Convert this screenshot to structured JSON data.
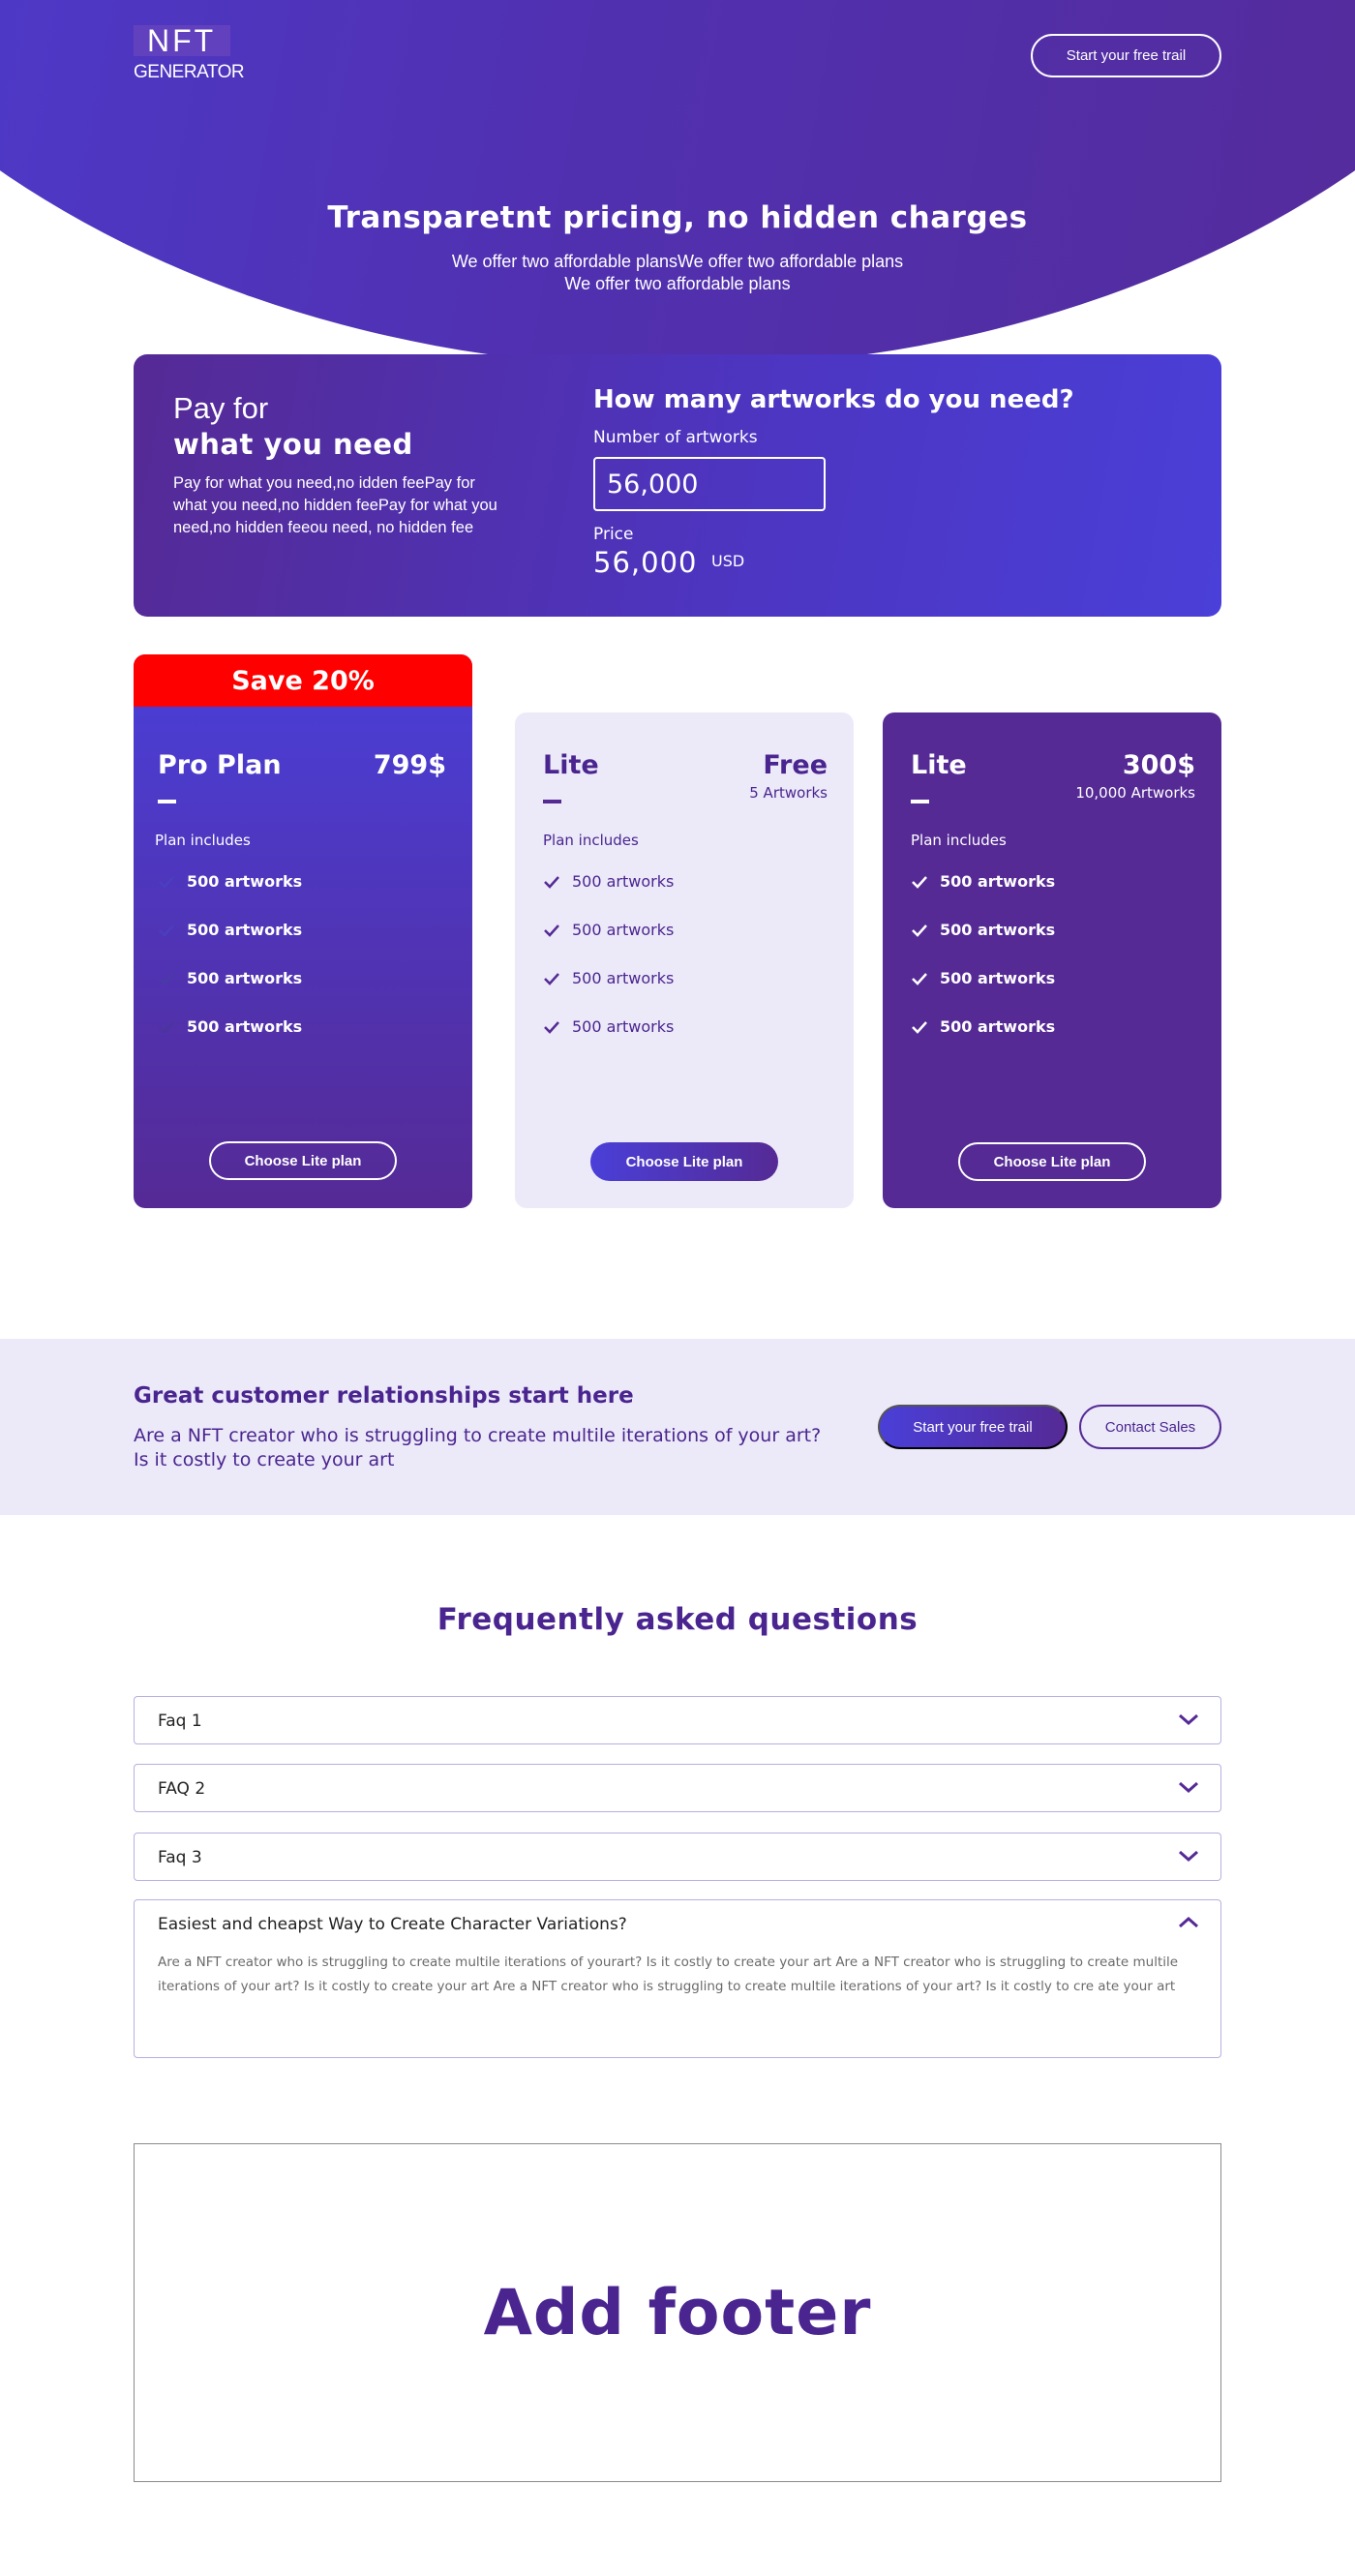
{
  "header": {
    "logo_top": "NFT",
    "logo_bottom": "GENERATOR",
    "cta_label": "Start your free trail"
  },
  "hero": {
    "title": "Transparetnt pricing, no hidden charges",
    "subtitle_line1": "We offer two affordable plansWe offer two affordable plans",
    "subtitle_line2": "We offer two affordable plans"
  },
  "calculator": {
    "pay_for": "Pay for",
    "what_you_need": "what you need",
    "description": "Pay for what you need,no idden feePay for what you need,no hidden feePay for what you need,no hidden feeou need, no hidden fee",
    "question": "How many artworks do you need?",
    "number_label": "Number of artworks",
    "number_value": "56,000",
    "price_label": "Price",
    "price_value": "56,000",
    "currency": "USD"
  },
  "plans": [
    {
      "banner": "Save 20%",
      "name": "Pro Plan",
      "price": "799$",
      "sub": "",
      "includes_label": "Plan includes",
      "features": [
        "500 artworks",
        "500 artworks",
        "500 artworks",
        "500 artworks"
      ],
      "button": "Choose Lite plan"
    },
    {
      "name": "Lite",
      "price": "Free",
      "sub": "5 Artworks",
      "includes_label": "Plan includes",
      "features": [
        "500 artworks",
        "500 artworks",
        "500 artworks",
        "500 artworks"
      ],
      "button": "Choose Lite plan"
    },
    {
      "name": "Lite",
      "price": "300$",
      "sub": "10,000 Artworks",
      "includes_label": "Plan includes",
      "features": [
        "500 artworks",
        "500 artworks",
        "500 artworks",
        "500 artworks"
      ],
      "button": "Choose Lite plan"
    }
  ],
  "cta": {
    "title": "Great customer relationships start here",
    "text": "Are a NFT creator who is struggling to create multile iterations of your art? Is it costly to create your art",
    "primary": "Start your free trail",
    "secondary": "Contact Sales"
  },
  "faq": {
    "title": "Frequently asked questions",
    "items": [
      {
        "q": "Faq 1"
      },
      {
        "q": "FAQ 2"
      },
      {
        "q": "Faq 3"
      },
      {
        "q": "Easiest and cheapst Way to Create Character Variations?",
        "a": "Are a NFT creator who is struggling to create multile iterations of yourart? Is it costly to create your art Are a NFT creator who is struggling to create multile iterations of your art? Is it costly to create your art Are a NFT creator who is struggling to create multile iterations of your  art? Is it costly to cre ate your art"
      }
    ]
  },
  "footer": {
    "placeholder": "Add footer"
  },
  "colors": {
    "brand_blue": "#4a3fd8",
    "brand_purple": "#552a95",
    "light_lavender": "#eceaf8",
    "save_red": "#ff0000"
  },
  "icons": {
    "check": "check-icon",
    "chevron_down": "chevron-down-icon",
    "chevron_up": "chevron-up-icon"
  }
}
